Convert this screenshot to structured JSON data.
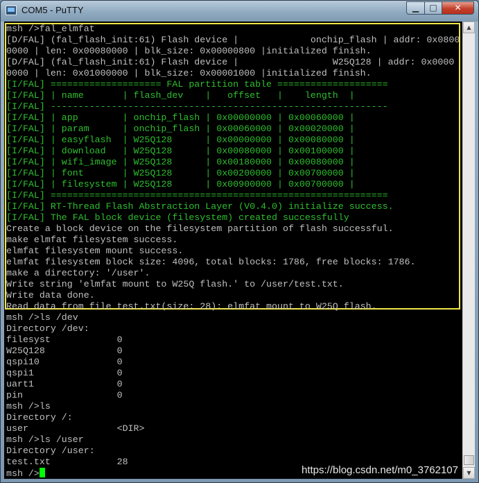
{
  "window": {
    "title": "COM5 - PuTTY",
    "controls": {
      "minimize": "▁",
      "maximize": "□",
      "close": "✕"
    },
    "title_icon": "putty-icon"
  },
  "terminal": {
    "highlight_color": "#f0e646",
    "lines": [
      {
        "text": "msh />fal_elmfat",
        "color": "white"
      },
      {
        "text": "[D/FAL] (fal_flash_init:61) Flash device |             onchip_flash | addr: 0x0800",
        "color": "white"
      },
      {
        "text": "0000 | len: 0x00080000 | blk_size: 0x00000800 |initialized finish.",
        "color": "white"
      },
      {
        "text": "[D/FAL] (fal_flash_init:61) Flash device |                 W25Q128 | addr: 0x0000",
        "color": "white"
      },
      {
        "text": "0000 | len: 0x01000000 | blk_size: 0x00001000 |initialized finish.",
        "color": "white"
      },
      {
        "text": "[I/FAL] ==================== FAL partition table ====================",
        "color": "green"
      },
      {
        "text": "[I/FAL] | name       | flash_dev    |   offset   |    length  |",
        "color": "green"
      },
      {
        "text": "[I/FAL] -------------------------------------------------------------",
        "color": "green"
      },
      {
        "text": "[I/FAL] | app        | onchip_flash | 0x00000000 | 0x00060000 |",
        "color": "green"
      },
      {
        "text": "[I/FAL] | param      | onchip_flash | 0x00060000 | 0x00020000 |",
        "color": "green"
      },
      {
        "text": "[I/FAL] | easyflash  | W25Q128      | 0x00000000 | 0x00080000 |",
        "color": "green"
      },
      {
        "text": "[I/FAL] | download   | W25Q128      | 0x00080000 | 0x00100000 |",
        "color": "green"
      },
      {
        "text": "[I/FAL] | wifi_image | W25Q128      | 0x00180000 | 0x00080000 |",
        "color": "green"
      },
      {
        "text": "[I/FAL] | font       | W25Q128      | 0x00200000 | 0x00700000 |",
        "color": "green"
      },
      {
        "text": "[I/FAL] | filesystem | W25Q128      | 0x00900000 | 0x00700000 |",
        "color": "green"
      },
      {
        "text": "[I/FAL] =============================================================",
        "color": "green"
      },
      {
        "text": "[I/FAL] RT-Thread Flash Abstraction Layer (V0.4.0) initialize success.",
        "color": "green"
      },
      {
        "text": "[I/FAL] The FAL block device (filesystem) created successfully",
        "color": "green"
      },
      {
        "text": "Create a block device on the filesystem partition of flash successful.",
        "color": "white"
      },
      {
        "text": "make elmfat filesystem success.",
        "color": "white"
      },
      {
        "text": "elmfat filesystem mount success.",
        "color": "white"
      },
      {
        "text": "elmfat filesystem block size: 4096, total blocks: 1786, free blocks: 1786.",
        "color": "white"
      },
      {
        "text": "make a directory: '/user'.",
        "color": "white"
      },
      {
        "text": "Write string 'elmfat mount to W25Q flash.' to /user/test.txt.",
        "color": "white"
      },
      {
        "text": "Write data done.",
        "color": "white"
      },
      {
        "text": "Read data from file test.txt(size: 28): elmfat mount to W25Q flash.",
        "color": "white"
      },
      {
        "text": "msh />ls /dev",
        "color": "white"
      },
      {
        "text": "Directory /dev:",
        "color": "white"
      },
      {
        "text": "filesyst            0",
        "color": "white"
      },
      {
        "text": "W25Q128             0",
        "color": "white"
      },
      {
        "text": "qspi10              0",
        "color": "white"
      },
      {
        "text": "qspi1               0",
        "color": "white"
      },
      {
        "text": "uart1               0",
        "color": "white"
      },
      {
        "text": "pin                 0",
        "color": "white"
      },
      {
        "text": "msh />ls",
        "color": "white"
      },
      {
        "text": "Directory /:",
        "color": "white"
      },
      {
        "text": "user                <DIR>",
        "color": "white"
      },
      {
        "text": "msh />ls /user",
        "color": "white"
      },
      {
        "text": "Directory /user:",
        "color": "white"
      },
      {
        "text": "test.txt            28",
        "color": "white"
      },
      {
        "text": "msh />",
        "color": "white",
        "cursor": true
      }
    ],
    "colors": {
      "white": "#c0c0c0",
      "green": "#2fbf2f",
      "cursor": "#00ff00",
      "background": "#000000"
    }
  },
  "scrollbar": {
    "up_icon": "scroll-up-arrow-icon",
    "down_icon": "scroll-down-arrow-icon"
  },
  "watermark": "https://blog.csdn.net/m0_3762107"
}
